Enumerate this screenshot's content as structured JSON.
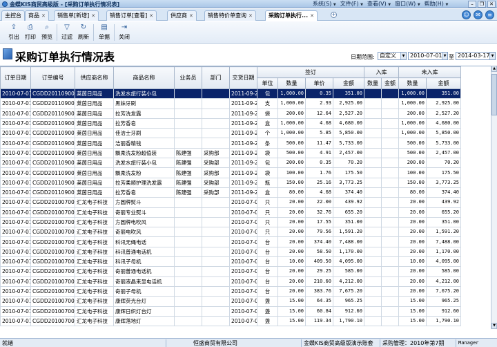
{
  "window": {
    "title": "金蝶KIS商贸高级版 - [采购订单执行情况表]"
  },
  "menu": [
    {
      "label": "系统(S)"
    },
    {
      "label": "文件(F)"
    },
    {
      "label": "查看(V)"
    },
    {
      "label": "窗口(W)"
    },
    {
      "label": "帮助(H)"
    }
  ],
  "tabs": [
    {
      "label": "主控台",
      "closable": false
    },
    {
      "label": "商品",
      "closable": true
    },
    {
      "label": "销售单[新增]",
      "closable": true
    },
    {
      "label": "销售订单[查看]",
      "closable": true
    },
    {
      "label": "供应商",
      "closable": true
    },
    {
      "label": "销售特价单查询",
      "closable": true
    },
    {
      "label": "采购订单执行...",
      "closable": true,
      "active": true
    }
  ],
  "toolbar": [
    {
      "label": "引出",
      "icon": "export-icon"
    },
    {
      "label": "打印",
      "icon": "print-icon"
    },
    {
      "label": "预览",
      "icon": "preview-icon"
    },
    {
      "label": "过滤",
      "icon": "filter-icon"
    },
    {
      "label": "刷新",
      "icon": "refresh-icon"
    },
    {
      "label": "单据",
      "icon": "document-icon"
    },
    {
      "label": "关闭",
      "icon": "close-icon"
    }
  ],
  "report": {
    "title": "采购订单执行情况表",
    "date_range_label": "日期范围:",
    "range_mode": "自定义",
    "date_from": "2010-07-01",
    "to_label": "至",
    "date_to": "2014-03-17"
  },
  "table": {
    "headers": {
      "order_date": "订单日期",
      "order_no": "订单编号",
      "supplier": "供应商名称",
      "product": "商品名称",
      "salesman": "业务员",
      "dept": "部门",
      "delivery_date": "交货日期",
      "ordered": "签订",
      "stock_in": "入库",
      "not_in": "未入库",
      "unit": "单位",
      "qty": "数量",
      "price": "单价",
      "amount": "金额"
    },
    "rows": [
      [
        "2010-07-01",
        "CGDD20110900002",
        "莱茵日用品",
        "洗发水旅行装小包",
        "",
        "",
        "2011-09-20",
        "包",
        "1,000.00",
        "0.35",
        "351.00",
        "",
        "",
        "1,000.00",
        "351.00"
      ],
      [
        "2010-07-01",
        "CGDD20110900002",
        "莱茵日用品",
        "黑妹牙刷",
        "",
        "",
        "2011-09-20",
        "支",
        "1,000.00",
        "2.93",
        "2,925.00",
        "",
        "",
        "1,000.00",
        "2,925.00"
      ],
      [
        "2010-07-01",
        "CGDD20110900002",
        "莱茵日用品",
        "拉芳洗发露",
        "",
        "",
        "2011-09-20",
        "袋",
        "200.00",
        "12.64",
        "2,527.20",
        "",
        "",
        "200.00",
        "2,527.20"
      ],
      [
        "2010-07-01",
        "CGDD20110900002",
        "莱茵日用品",
        "拉芳香皂",
        "",
        "",
        "2011-09-20",
        "盒",
        "1,000.00",
        "4.68",
        "4,680.00",
        "",
        "",
        "1,000.00",
        "4,680.00"
      ],
      [
        "2010-07-01",
        "CGDD20110900002",
        "莱茵日用品",
        "佳洁士牙刷",
        "",
        "",
        "2011-09-20",
        "个",
        "1,000.00",
        "5.85",
        "5,850.00",
        "",
        "",
        "1,000.00",
        "5,850.00"
      ],
      [
        "2010-07-01",
        "CGDD20110900002",
        "莱茵日用品",
        "洁丽香精钱",
        "",
        "",
        "2011-09-20",
        "条",
        "500.00",
        "11.47",
        "5,733.00",
        "",
        "",
        "500.00",
        "5,733.00"
      ],
      [
        "2010-07-01",
        "CGDD20110900001",
        "莱茵日用品",
        "飘柔洗发粉超值装",
        "陈建强",
        "采购部",
        "2011-09-20",
        "袋",
        "500.00",
        "4.91",
        "2,457.00",
        "",
        "",
        "500.00",
        "2,457.00"
      ],
      [
        "2010-07-01",
        "CGDD20110900001",
        "莱茵日用品",
        "洗发水旅行装小包",
        "陈建强",
        "采购部",
        "2011-09-20",
        "包",
        "200.00",
        "0.35",
        "70.20",
        "",
        "",
        "200.00",
        "70.20"
      ],
      [
        "2010-07-01",
        "CGDD20110900001",
        "莱茵日用品",
        "飘柔洗发粉",
        "陈建强",
        "采购部",
        "2011-09-20",
        "袋",
        "100.00",
        "1.76",
        "175.50",
        "",
        "",
        "100.00",
        "175.50"
      ],
      [
        "2010-07-01",
        "CGDD20110900001",
        "莱茵日用品",
        "拉芳柔顺护理洗发露",
        "陈建强",
        "采购部",
        "2011-09-20",
        "瓶",
        "150.00",
        "25.16",
        "3,773.25",
        "",
        "",
        "150.00",
        "3,773.25"
      ],
      [
        "2010-07-01",
        "CGDD20110900001",
        "莱茵日用品",
        "拉芳香皂",
        "陈建强",
        "采购部",
        "2011-09-20",
        "盒",
        "80.00",
        "4.68",
        "374.40",
        "",
        "",
        "80.00",
        "374.40"
      ],
      [
        "2010-07-01",
        "CGDD20100700015",
        "汇龙电子科技",
        "方圆牌熨斗",
        "",
        "",
        "2010-07-03",
        "只",
        "20.00",
        "22.00",
        "439.92",
        "",
        "",
        "20.00",
        "439.92"
      ],
      [
        "2010-07-01",
        "CGDD20100700015",
        "汇龙电子科技",
        "奇丽专业熨斗",
        "",
        "",
        "2010-07-03",
        "只",
        "20.00",
        "32.76",
        "655.20",
        "",
        "",
        "20.00",
        "655.20"
      ],
      [
        "2010-07-01",
        "CGDD20100700015",
        "汇龙电子科技",
        "方圆牌电吹风",
        "",
        "",
        "2010-07-03",
        "只",
        "20.00",
        "17.55",
        "351.00",
        "",
        "",
        "20.00",
        "351.00"
      ],
      [
        "2010-07-01",
        "CGDD20100700015",
        "汇龙电子科技",
        "奇丽电吹风",
        "",
        "",
        "2010-07-03",
        "只",
        "20.00",
        "79.56",
        "1,591.20",
        "",
        "",
        "20.00",
        "1,591.20"
      ],
      [
        "2010-07-01",
        "CGDD20100700015",
        "汇龙电子科技",
        "科讯无绳电话",
        "",
        "",
        "2010-07-03",
        "台",
        "20.00",
        "374.40",
        "7,488.00",
        "",
        "",
        "20.00",
        "7,488.00"
      ],
      [
        "2010-07-01",
        "CGDD20100700015",
        "汇龙电子科技",
        "科讯普通电话机",
        "",
        "",
        "2010-07-03",
        "台",
        "20.00",
        "58.50",
        "1,170.00",
        "",
        "",
        "20.00",
        "1,170.00"
      ],
      [
        "2010-07-01",
        "CGDD20100700015",
        "汇龙电子科技",
        "科讯子母机",
        "",
        "",
        "2010-07-03",
        "台",
        "10.00",
        "409.50",
        "4,095.00",
        "",
        "",
        "10.00",
        "4,095.00"
      ],
      [
        "2010-07-01",
        "CGDD20100700015",
        "汇龙电子科技",
        "奇丽普通电话机",
        "",
        "",
        "2010-07-03",
        "台",
        "20.00",
        "29.25",
        "585.00",
        "",
        "",
        "20.00",
        "585.00"
      ],
      [
        "2010-07-01",
        "CGDD20100700015",
        "汇龙电子科技",
        "奇丽液晶来显电话机",
        "",
        "",
        "2010-07-03",
        "台",
        "20.00",
        "210.60",
        "4,212.00",
        "",
        "",
        "20.00",
        "4,212.00"
      ],
      [
        "2010-07-01",
        "CGDD20100700015",
        "汇龙电子科技",
        "奇丽子母机",
        "",
        "",
        "2010-07-03",
        "台",
        "20.00",
        "383.76",
        "7,675.20",
        "",
        "",
        "20.00",
        "7,675.20"
      ],
      [
        "2010-07-01",
        "CGDD20100700015",
        "汇龙电子科技",
        "康辉荧光台灯",
        "",
        "",
        "2010-07-03",
        "盏",
        "15.00",
        "64.35",
        "965.25",
        "",
        "",
        "15.00",
        "965.25"
      ],
      [
        "2010-07-01",
        "CGDD20100700015",
        "汇龙电子科技",
        "康辉日织灯台灯",
        "",
        "",
        "2010-07-03",
        "盏",
        "15.00",
        "60.84",
        "912.60",
        "",
        "",
        "15.00",
        "912.60"
      ],
      [
        "2010-07-01",
        "CGDD20100700015",
        "汇龙电子科技",
        "康辉落地灯",
        "",
        "",
        "2010-07-03",
        "盏",
        "15.00",
        "119.34",
        "1,790.10",
        "",
        "",
        "15.00",
        "1,790.10"
      ]
    ]
  },
  "statusbar": {
    "left": "就绪",
    "company": "恒盛商贸有限公司",
    "edition": "金蝶KIS商贸高级版演示账套",
    "period": "采购管理：2010年第7期",
    "user": "Manager"
  }
}
